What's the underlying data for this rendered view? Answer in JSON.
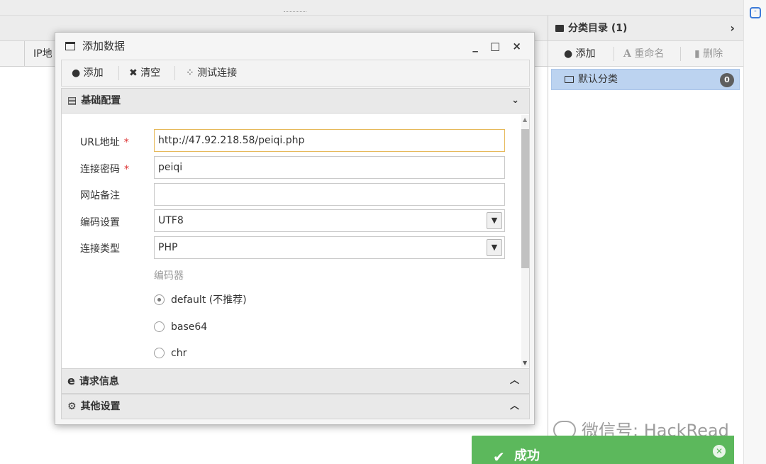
{
  "list": {
    "col_ip": "IP地"
  },
  "category_panel": {
    "title": "分类目录 (1)",
    "chevron": "›",
    "add_label": "添加",
    "rename_label": "重命名",
    "delete_label": "删除",
    "items": [
      {
        "label": "默认分类",
        "count": "0"
      }
    ]
  },
  "dialog": {
    "title": "添加数据",
    "controls": "_ □ ×",
    "toolbar": {
      "add_label": "添加",
      "clear_label": "清空",
      "test_label": "测试连接"
    },
    "sections": {
      "basic": "基础配置",
      "request": "请求信息",
      "other": "其他设置"
    },
    "fields": {
      "url_label": "URL地址",
      "url_value": "http://47.92.218.58/peiqi.php",
      "password_label": "连接密码",
      "password_value": "peiqi",
      "note_label": "网站备注",
      "note_value": "",
      "encoding_label": "编码设置",
      "encoding_value": "UTF8",
      "type_label": "连接类型",
      "type_value": "PHP",
      "encoder_label": "编码器",
      "encoders": [
        "default (不推荐)",
        "base64",
        "chr"
      ],
      "selected_encoder": "default (不推荐)",
      "required_mark": "*"
    }
  },
  "toast": {
    "message": "成功"
  },
  "watermark": "微信号: HackRead",
  "colors": {
    "accent_selected": "#bcd3f0",
    "toast_green": "#5cb85c",
    "required_red": "#dd3333",
    "focus_border": "#e6b95a"
  }
}
